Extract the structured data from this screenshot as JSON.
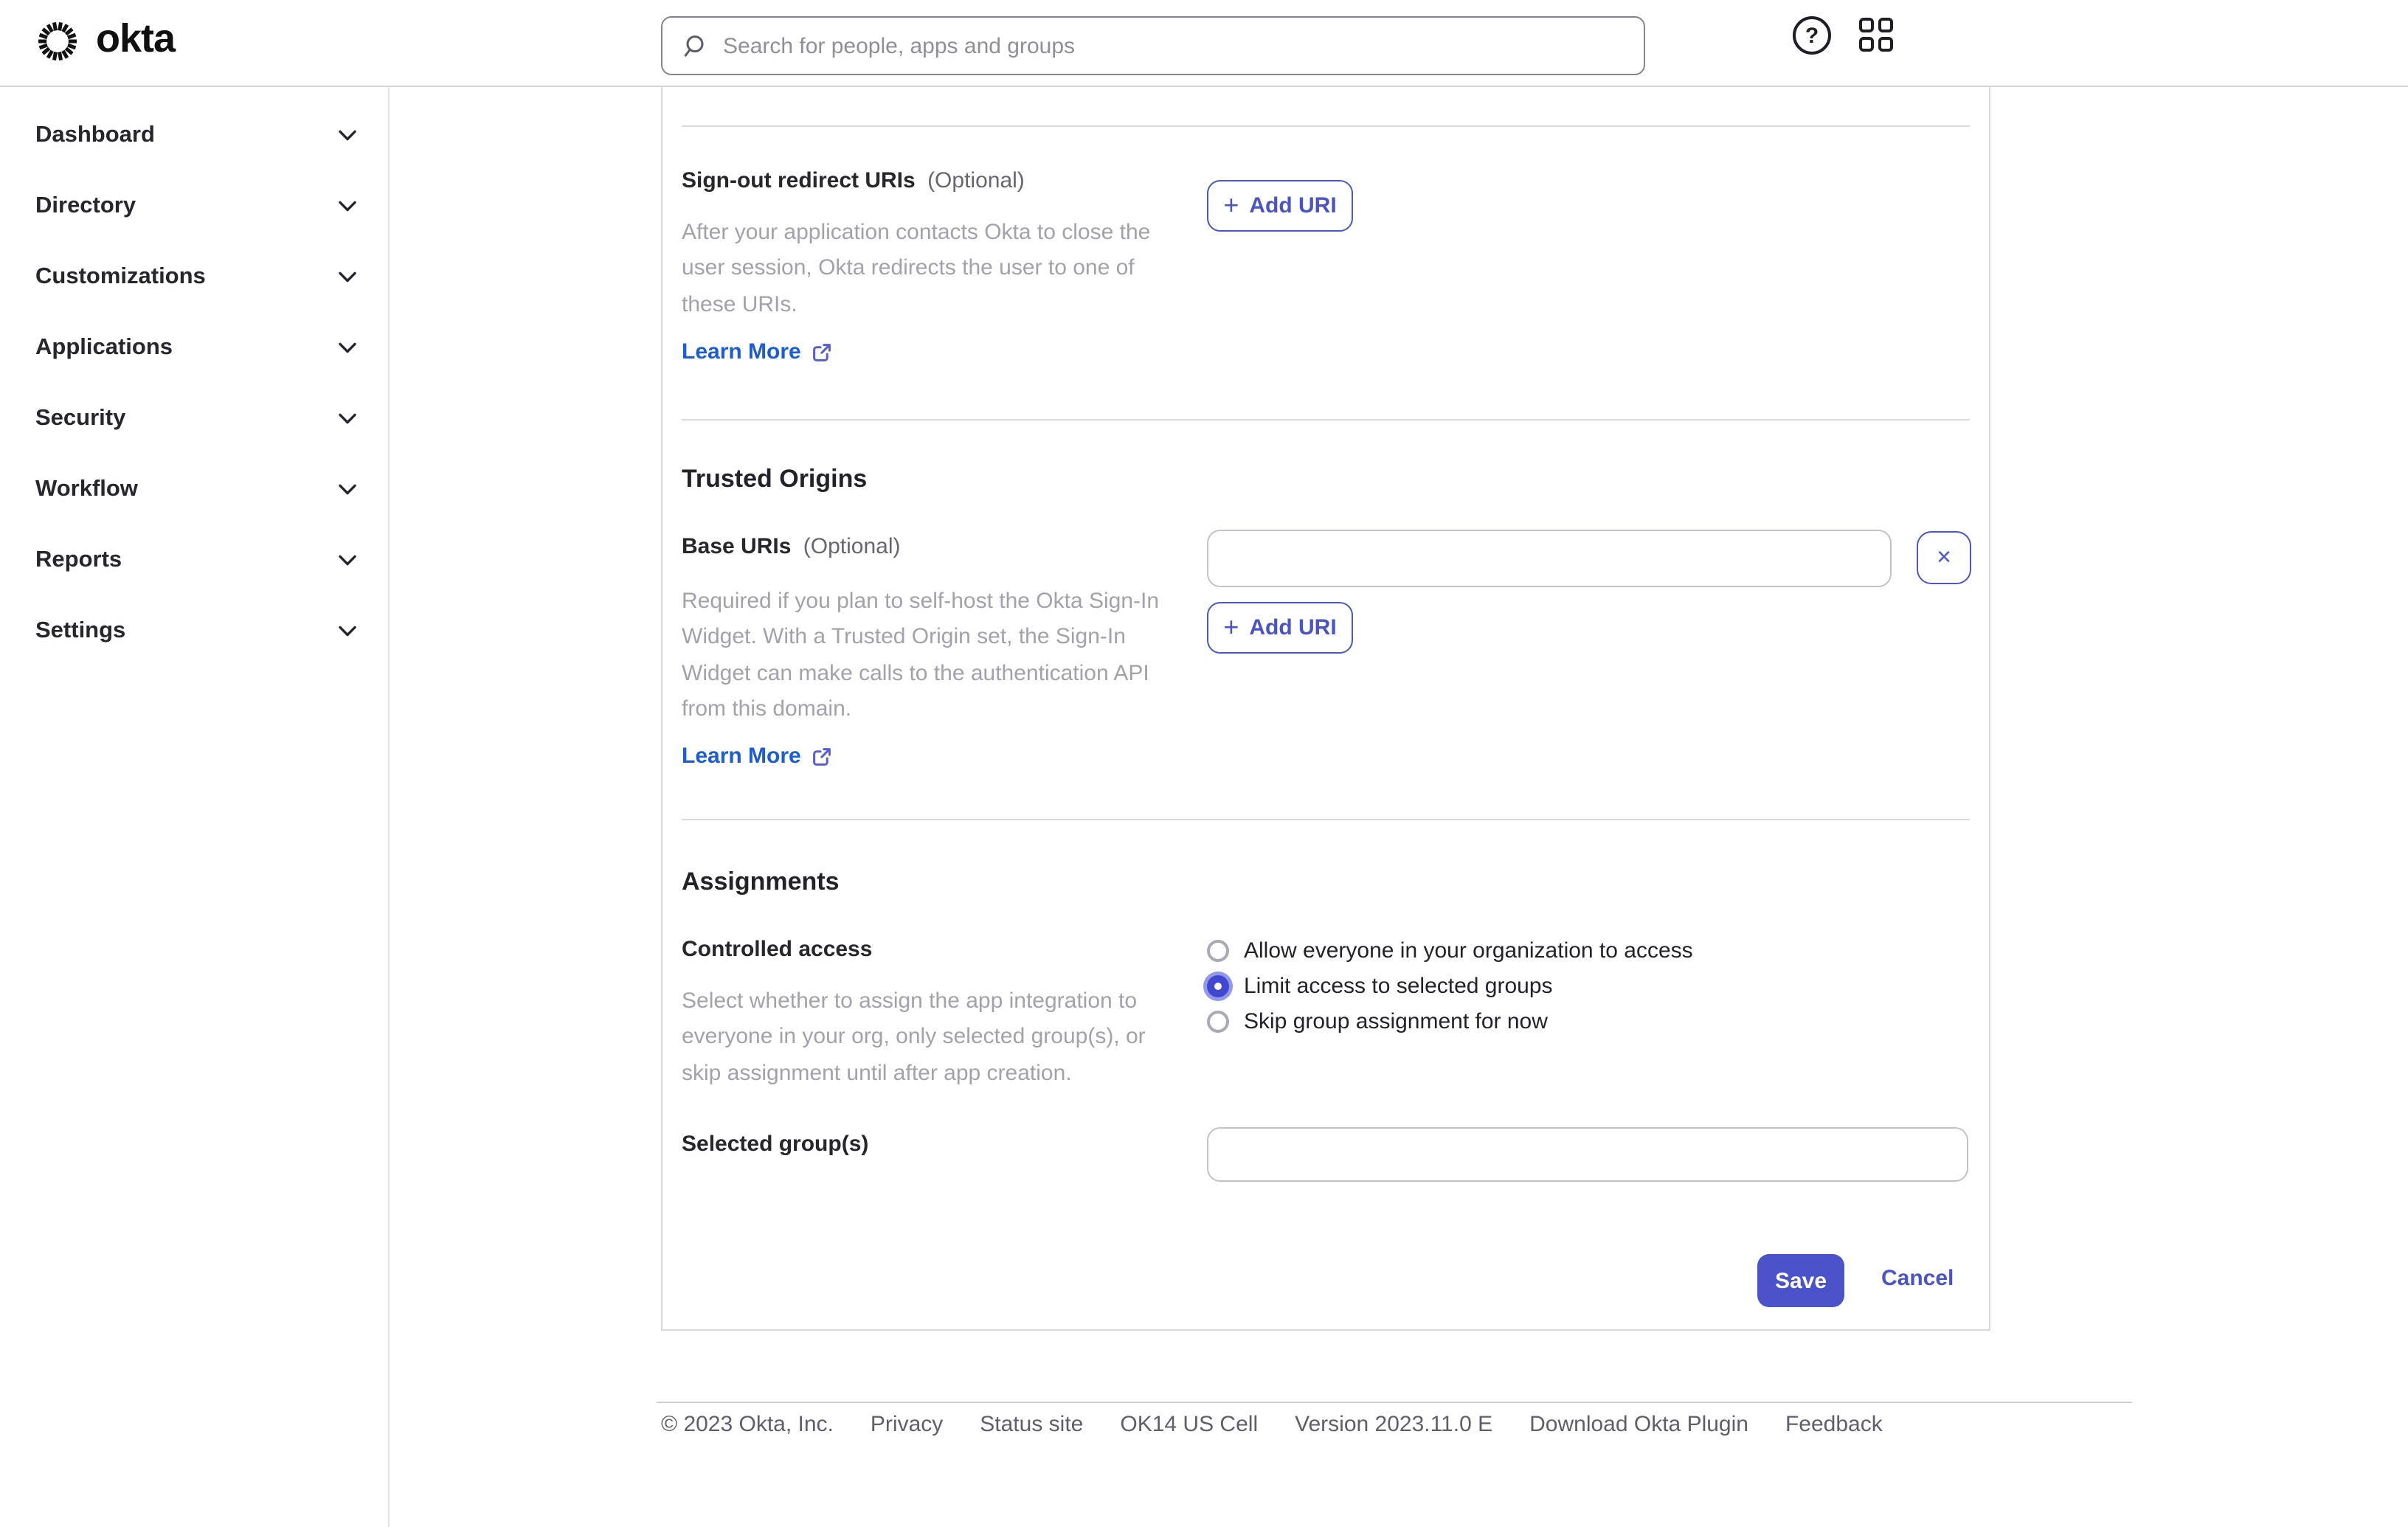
{
  "topbar": {
    "brand": "okta",
    "search": {
      "placeholder": "Search for people, apps and groups",
      "value": ""
    },
    "help_glyph": "?"
  },
  "sidebar": {
    "items": [
      "Dashboard",
      "Directory",
      "Customizations",
      "Applications",
      "Security",
      "Workflow",
      "Reports",
      "Settings"
    ]
  },
  "signout": {
    "label": "Sign-out redirect URIs",
    "optional": "(Optional)",
    "description_lines": [
      "After your application contacts Okta to close the",
      "user session, Okta redirects the user to one of",
      "these URIs."
    ],
    "learn_more": "Learn More",
    "add_uri": "Add URI"
  },
  "trusted_origins": {
    "heading": "Trusted Origins",
    "label": "Base URIs",
    "optional": "(Optional)",
    "input_value": "",
    "remove_glyph": "×",
    "description_lines": [
      "Required if you plan to self-host the Okta Sign-In",
      "Widget. With a Trusted Origin set, the Sign-In",
      "Widget can make calls to the authentication API",
      "from this domain."
    ],
    "learn_more": "Learn More",
    "add_uri": "Add URI"
  },
  "assignments": {
    "heading": "Assignments",
    "label": "Controlled access",
    "description_lines": [
      "Select whether to assign the app integration to",
      "everyone in your org, only selected group(s), or",
      "skip assignment until after app creation."
    ],
    "options": [
      {
        "label": "Allow everyone in your organization to access",
        "selected": false
      },
      {
        "label": "Limit access to selected groups",
        "selected": true
      },
      {
        "label": "Skip group assignment for now",
        "selected": false
      }
    ],
    "selected_groups_label": "Selected group(s)",
    "selected_groups_value": ""
  },
  "actions": {
    "save": "Save",
    "cancel": "Cancel"
  },
  "footer": {
    "items": [
      "© 2023 Okta, Inc.",
      "Privacy",
      "Status site",
      "OK14 US Cell",
      "Version 2023.11.0 E",
      "Download Okta Plugin",
      "Feedback"
    ]
  },
  "icons": {
    "plus": "+"
  },
  "colors": {
    "primary_button": "#4a53c9",
    "accent_indigo": "#4c55c9",
    "link_blue": "#1b5cd7",
    "radio_selected": "#3f48cf",
    "text_primary": "#26262b",
    "text_muted": "#a2a2aa"
  }
}
